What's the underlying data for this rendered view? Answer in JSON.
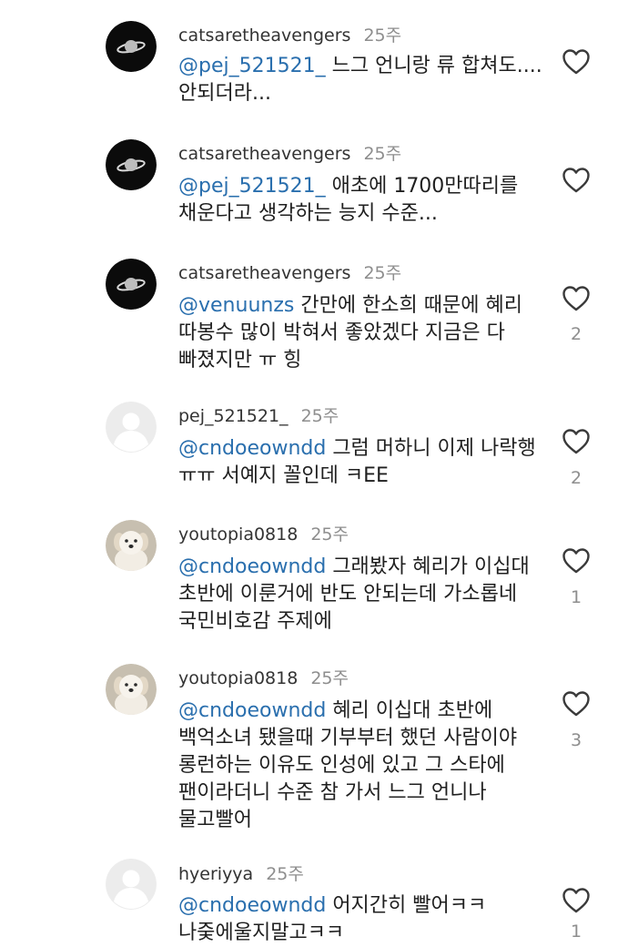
{
  "comments": [
    {
      "username": "catsaretheavengers",
      "time": "25주",
      "avatar": "saturn-icon",
      "mention": "@pej_521521_",
      "lines": [
        " 느그 언니랑 류 합쳐도....",
        "안되더라..."
      ],
      "likes": ""
    },
    {
      "username": "catsaretheavengers",
      "time": "25주",
      "avatar": "saturn-icon",
      "mention": "@pej_521521_",
      "lines": [
        " 애초에 1700만따리를",
        "채운다고 생각하는 능지 수준..."
      ],
      "likes": ""
    },
    {
      "username": "catsaretheavengers",
      "time": "25주",
      "avatar": "saturn-icon",
      "mention": "@venuunzs",
      "lines": [
        " 간만에 한소희 때문에 혜리",
        "따봉수 많이 박혀서 좋았겠다 지금은 다",
        "빠졌지만 ㅠ 힝"
      ],
      "likes": "2"
    },
    {
      "username": "pej_521521_",
      "time": "25주",
      "avatar": "default-avatar-icon",
      "mention": "@cndoeowndd",
      "lines": [
        " 그럼 머하니 이제 나락행",
        "ㅠㅠ 서예지 꼴인데 ㅋEE"
      ],
      "likes": "2"
    },
    {
      "username": "youtopia0818",
      "time": "25주",
      "avatar": "puppy-avatar",
      "mention": "@cndoeowndd",
      "lines": [
        " 그래봤자 혜리가 이십대",
        "초반에 이룬거에 반도 안되는데 가소롭네",
        "국민비호감 주제에"
      ],
      "likes": "1"
    },
    {
      "username": "youtopia0818",
      "time": "25주",
      "avatar": "puppy-avatar",
      "mention": "@cndoeowndd",
      "lines": [
        " 혜리 이십대 초반에",
        "백억소녀 됐을때 기부부터 했던 사람이야",
        "롱런하는 이유도 인성에 있고 그 스타에",
        "팬이라더니 수준 참 가서 느그 언니나",
        "물고빨어"
      ],
      "likes": "3"
    },
    {
      "username": "hyeriyya",
      "time": "25주",
      "avatar": "default-avatar-icon",
      "mention": "@cndoeowndd",
      "lines": [
        " 어지간히 빨어ㅋㅋ",
        "나줒에울지말고ㅋㅋ"
      ],
      "likes": "1"
    }
  ]
}
